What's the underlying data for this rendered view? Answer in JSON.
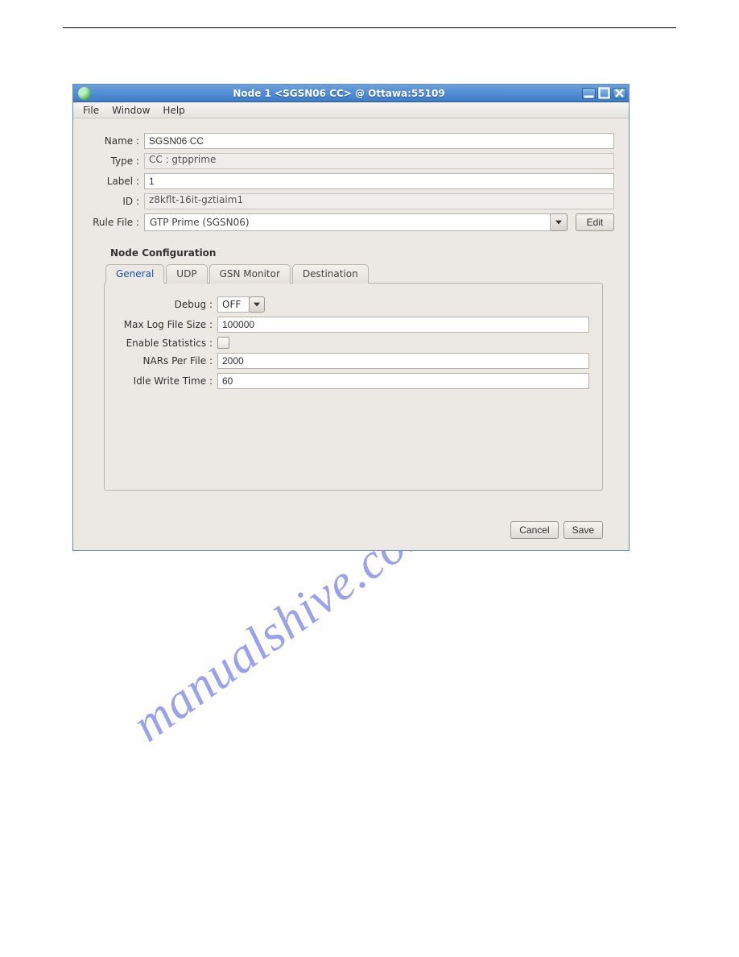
{
  "window": {
    "title": "Node 1 <SGSN06 CC> @ Ottawa:55109"
  },
  "menubar": {
    "file": "File",
    "window": "Window",
    "help": "Help"
  },
  "form": {
    "name_label": "Name :",
    "name_value": "SGSN06 CC",
    "type_label": "Type :",
    "type_value": "CC : gtpprime",
    "label_label": "Label :",
    "label_value": "1",
    "id_label": "ID :",
    "id_value": "z8kflt-16it-gztiaim1",
    "rule_label": "Rule File :",
    "rule_value": "GTP Prime (SGSN06)",
    "edit_label": "Edit"
  },
  "section_title": "Node Configuration",
  "tabs": {
    "general": "General",
    "udp": "UDP",
    "gsn": "GSN Monitor",
    "dest": "Destination"
  },
  "general_tab": {
    "debug_label": "Debug :",
    "debug_value": "OFF",
    "maxlog_label": "Max Log File Size :",
    "maxlog_value": "100000",
    "stats_label": "Enable Statistics :",
    "nars_label": "NARs Per File :",
    "nars_value": "2000",
    "idle_label": "Idle Write Time :",
    "idle_value": "60"
  },
  "buttons": {
    "cancel": "Cancel",
    "save": "Save"
  },
  "watermark": "manualshive.com"
}
